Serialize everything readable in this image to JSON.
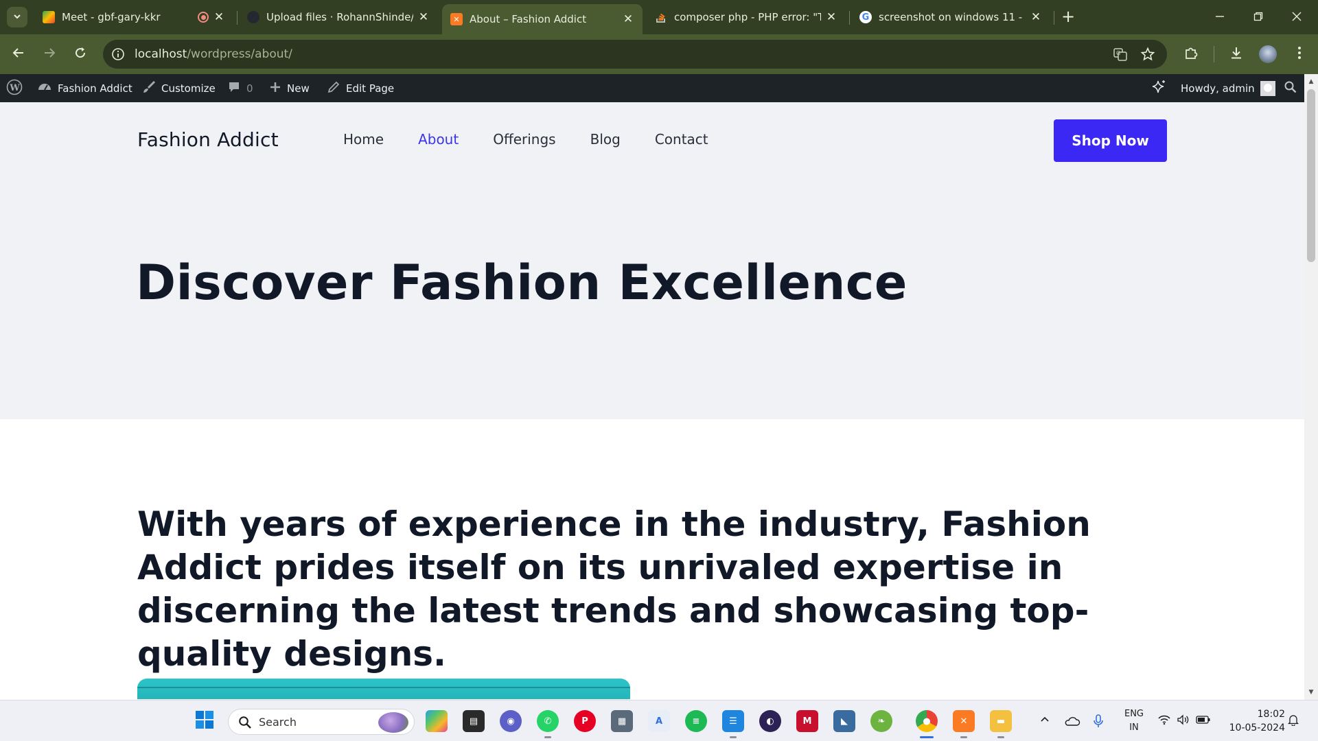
{
  "browser": {
    "tabs": [
      {
        "title": "Meet - gbf-gary-kkr",
        "active": false,
        "favicon": "google-meet-icon"
      },
      {
        "title": "Upload files · RohannShinde/W",
        "active": false,
        "favicon": "github-icon"
      },
      {
        "title": "About – Fashion Addict",
        "active": true,
        "favicon": "xampp-icon"
      },
      {
        "title": "composer php - PHP error: \"The",
        "active": false,
        "favicon": "stackoverflow-icon"
      },
      {
        "title": "screenshot on windows 11 - Go",
        "active": false,
        "favicon": "google-icon"
      }
    ],
    "url_host": "localhost",
    "url_path": "/wordpress/about/"
  },
  "adminbar": {
    "site_name": "Fashion Addict",
    "customize": "Customize",
    "comments_count": "0",
    "new": "New",
    "edit_page": "Edit Page",
    "howdy": "Howdy, admin"
  },
  "site": {
    "title": "Fashion Addict",
    "nav": [
      {
        "label": "Home",
        "current": false
      },
      {
        "label": "About",
        "current": true
      },
      {
        "label": "Offerings",
        "current": false
      },
      {
        "label": "Blog",
        "current": false
      },
      {
        "label": "Contact",
        "current": false
      }
    ],
    "cta": "Shop Now",
    "hero_title": "Discover Fashion Excellence",
    "intro": "With years of experience in the industry, Fashion Addict prides itself on its unrivaled expertise in discerning the latest trends and showcasing top-quality designs."
  },
  "taskbar": {
    "search_label": "Search",
    "lang_line1": "ENG",
    "lang_line2": "IN",
    "time": "18:02",
    "date": "10-05-2024"
  },
  "colors": {
    "accent": "#3b28f5",
    "nav_current": "#3a35e6",
    "browser_frame": "#4a5a31",
    "admin_bar": "#1d2327"
  }
}
